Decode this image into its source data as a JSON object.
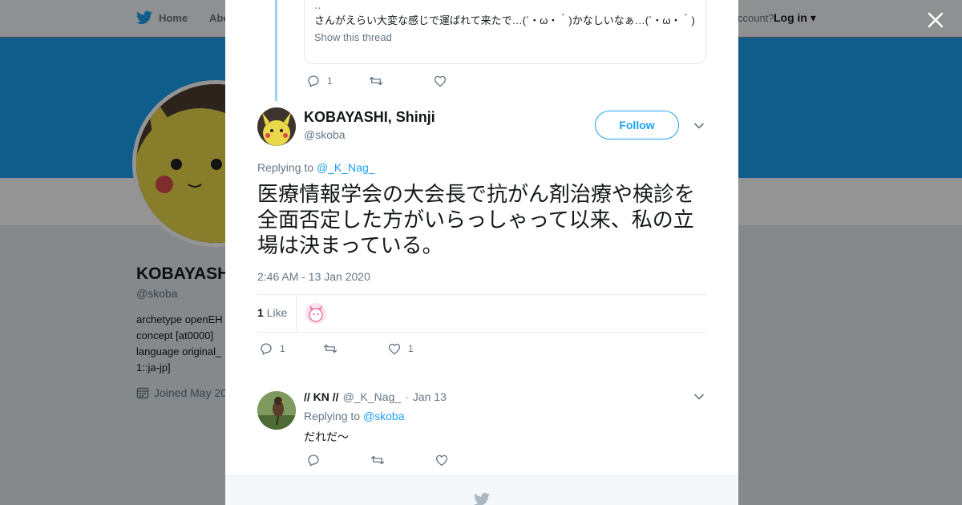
{
  "topbar": {
    "home_label": "Home",
    "about_label": "Abo",
    "account_label": "ccount?",
    "login_label": "Log in"
  },
  "profile": {
    "name": "KOBAYASH",
    "handle": "@skoba",
    "bio": "archetype openEH concept [at0000] language original_ 1::ja-jp]",
    "joined": "Joined May 20"
  },
  "parent_tweet": {
    "quote_text": "さんがえらい大変な感じで運ばれて来たで…(´・ω・｀)かなしいなぁ…(´・ω・｀)",
    "show_thread": "Show this thread",
    "reply_count": "1",
    "retweet_count": "",
    "like_count": ""
  },
  "main_tweet": {
    "name": "KOBAYASHI, Shinji",
    "handle": "@skoba",
    "follow_label": "Follow",
    "replying_prefix": "Replying to",
    "replying_to": "@_K_Nag_",
    "text": "医療情報学会の大会長で抗がん剤治療や検診を全面否定した方がいらっしゃって以来、私の立場は決まっている。",
    "timestamp": "2:46 AM - 13 Jan 2020",
    "likes_count": "1",
    "likes_label": "Like",
    "reply_count": "1",
    "retweet_count": "",
    "like_count": "1"
  },
  "reply": {
    "name": "// KN //",
    "handle": "@_K_Nag_",
    "dot": "·",
    "date": "Jan 13",
    "replying_prefix": "Replying to",
    "replying_to": "@skoba",
    "text": "だれだ～"
  },
  "colors": {
    "accent": "#1da1f2",
    "thread_line": "#9ad1f9",
    "muted": "#657786"
  },
  "icons": [
    "twitter-bird-icon",
    "close-icon",
    "reply-icon",
    "retweet-icon",
    "heart-icon",
    "chevron-down-icon",
    "calendar-icon"
  ]
}
